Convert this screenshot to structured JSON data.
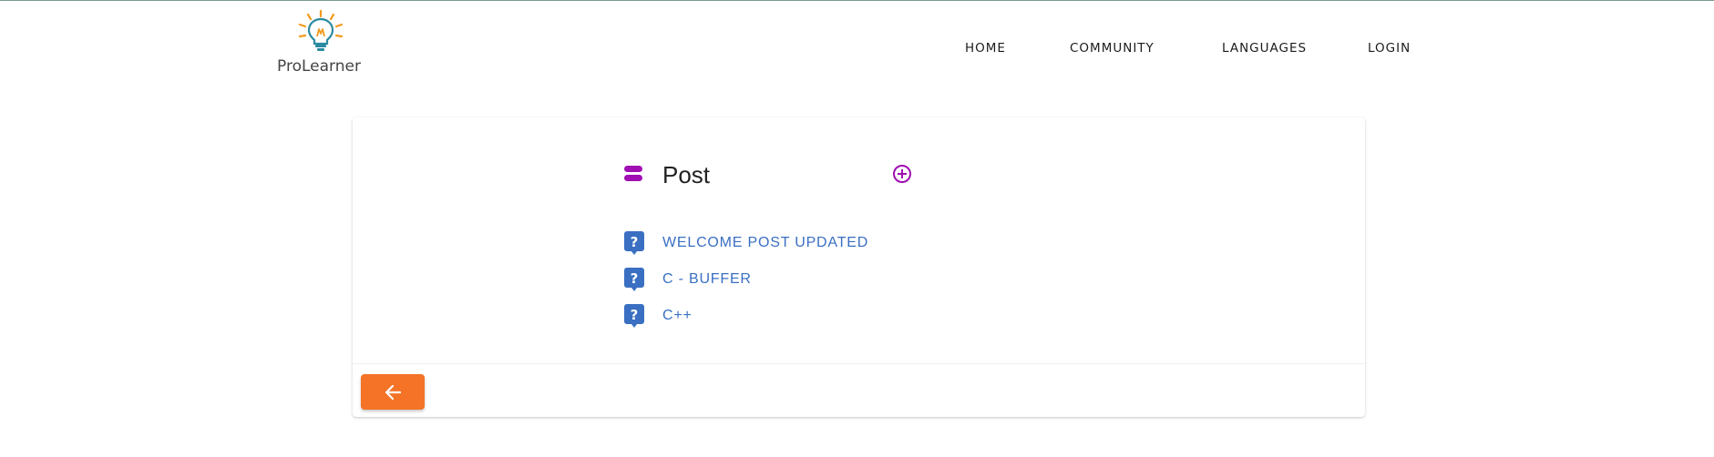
{
  "brand": {
    "name": "ProLearner",
    "logo_icon": "lightbulb-icon"
  },
  "nav": {
    "items": [
      {
        "label": "HOME"
      },
      {
        "label": "COMMUNITY"
      },
      {
        "label": "LANGUAGES"
      },
      {
        "label": "LOGIN"
      }
    ]
  },
  "main": {
    "header_icon": "list-icon",
    "title": "Post",
    "add_icon": "plus-circle-icon",
    "posts": [
      {
        "title": "WELCOME POST UPDATED",
        "icon": "question-icon"
      },
      {
        "title": "C - BUFFER",
        "icon": "question-icon"
      },
      {
        "title": "C++",
        "icon": "question-icon"
      }
    ],
    "back_icon": "arrow-left-icon"
  },
  "colors": {
    "accent_purple": "#a00fb3",
    "link_blue": "#3a6fc2",
    "back_button": "#f47327",
    "logo_orange": "#f39a1e",
    "logo_teal": "#2b8aa0"
  }
}
